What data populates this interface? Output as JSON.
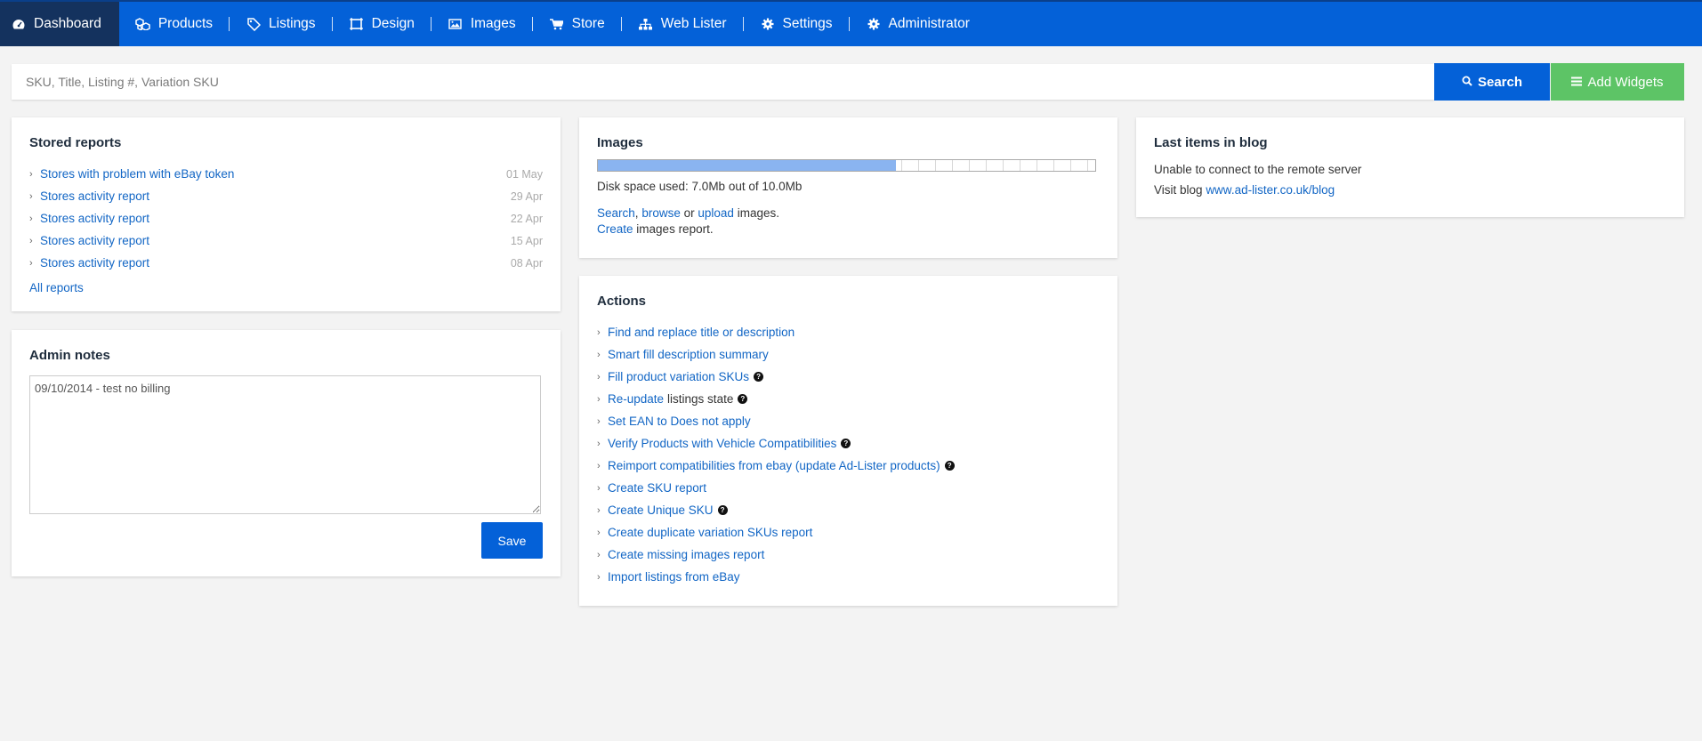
{
  "nav": {
    "items": [
      {
        "label": "Dashboard",
        "icon": "dashboard-icon"
      },
      {
        "label": "Products",
        "icon": "cubes-icon"
      },
      {
        "label": "Listings",
        "icon": "tags-icon"
      },
      {
        "label": "Design",
        "icon": "design-icon"
      },
      {
        "label": "Images",
        "icon": "image-icon"
      },
      {
        "label": "Store",
        "icon": "cart-icon"
      },
      {
        "label": "Web Lister",
        "icon": "sitemap-icon"
      },
      {
        "label": "Settings",
        "icon": "gear-icon"
      },
      {
        "label": "Administrator",
        "icon": "gear-icon"
      }
    ],
    "active": "Dashboard",
    "colors": {
      "bar": "#0461d8",
      "active": "#14325e"
    }
  },
  "search": {
    "placeholder": "SKU, Title, Listing #, Variation SKU",
    "value": "",
    "button_label": "Search",
    "widgets_label": "Add Widgets",
    "colors": {
      "search": "#0461d8",
      "widgets": "#5dc466"
    }
  },
  "stored_reports": {
    "title": "Stored reports",
    "items": [
      {
        "label": "Stores with problem with eBay token",
        "date": "01 May"
      },
      {
        "label": "Stores activity report",
        "date": "29 Apr"
      },
      {
        "label": "Stores activity report",
        "date": "22 Apr"
      },
      {
        "label": "Stores activity report",
        "date": "15 Apr"
      },
      {
        "label": "Stores activity report",
        "date": "08 Apr"
      }
    ],
    "all_link": "All reports"
  },
  "admin_notes": {
    "title": "Admin notes",
    "value": "09/10/2014 - test no billing",
    "save_label": "Save"
  },
  "images": {
    "title": "Images",
    "used_fraction": 0.6,
    "disk_text": "Disk space used: 7.0Mb out of 10.0Mb",
    "links": {
      "search": "Search",
      "sep1": ",",
      "browse": "browse",
      "or": "or",
      "upload": "upload",
      "tail": "images.",
      "create": "Create",
      "create_tail": "images report."
    }
  },
  "actions": {
    "title": "Actions",
    "items": [
      {
        "link": "Find and replace title or description",
        "rest": "",
        "help": false
      },
      {
        "link": "Smart fill description summary",
        "rest": "",
        "help": false
      },
      {
        "link": "Fill product variation SKUs",
        "rest": "",
        "help": true
      },
      {
        "link": "Re-update",
        "rest": "listings state",
        "help": true
      },
      {
        "link": "Set EAN to Does not apply",
        "rest": "",
        "help": false
      },
      {
        "link": "Verify Products with Vehicle Compatibilities",
        "rest": "",
        "help": true
      },
      {
        "link": "Reimport compatibilities from ebay (update Ad-Lister products)",
        "rest": "",
        "help": true
      },
      {
        "link": "Create SKU report",
        "rest": "",
        "help": false
      },
      {
        "link": "Create Unique SKU",
        "rest": "",
        "help": true
      },
      {
        "link": "Create duplicate variation SKUs report",
        "rest": "",
        "help": false
      },
      {
        "link": "Create missing images report",
        "rest": "",
        "help": false
      },
      {
        "link": "Import listings from eBay",
        "rest": "",
        "help": false
      }
    ]
  },
  "blog": {
    "title": "Last items in blog",
    "message": "Unable to connect to the remote server",
    "visit_prefix": "Visit blog",
    "url": "www.ad-lister.co.uk/blog"
  }
}
